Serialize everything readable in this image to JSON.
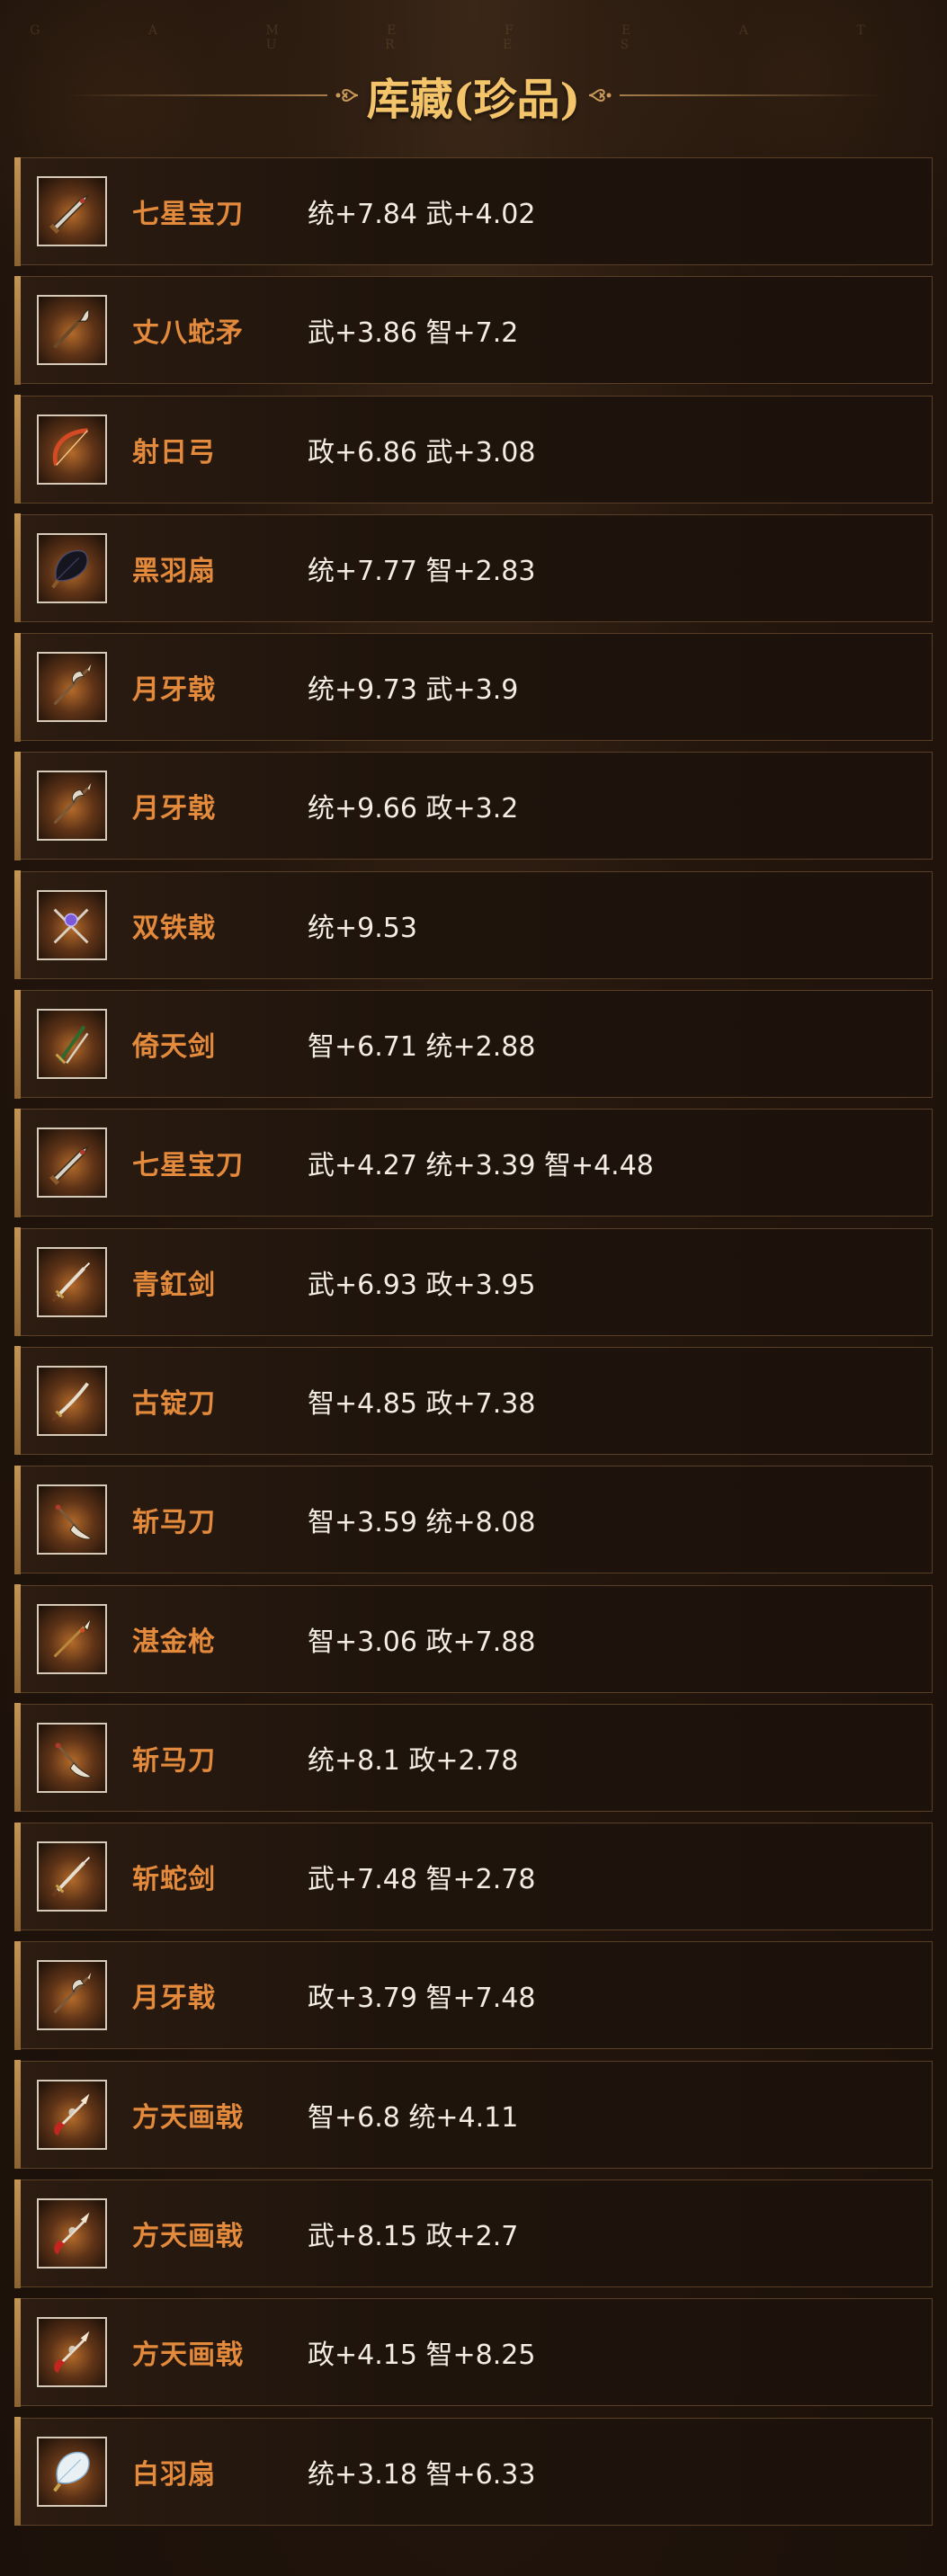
{
  "header": {
    "subtitle": "G A M E   F E A T U R E S",
    "title": "库藏(珍品)"
  },
  "items": [
    {
      "name": "七星宝刀",
      "stats": "统+7.84 武+4.02",
      "icon": "broadsword-icon"
    },
    {
      "name": "丈八蛇矛",
      "stats": "武+3.86 智+7.2",
      "icon": "serpent-spear-icon"
    },
    {
      "name": "射日弓",
      "stats": "政+6.86 武+3.08",
      "icon": "bow-icon"
    },
    {
      "name": "黑羽扇",
      "stats": "统+7.77 智+2.83",
      "icon": "black-feather-fan-icon"
    },
    {
      "name": "月牙戟",
      "stats": "统+9.73 武+3.9",
      "icon": "crescent-halberd-icon"
    },
    {
      "name": "月牙戟",
      "stats": "统+9.66 政+3.2",
      "icon": "crescent-halberd-icon"
    },
    {
      "name": "双铁戟",
      "stats": "统+9.53",
      "icon": "twin-halberd-icon"
    },
    {
      "name": "倚天剑",
      "stats": "智+6.71 统+2.88",
      "icon": "sword-pair-icon"
    },
    {
      "name": "七星宝刀",
      "stats": "武+4.27 统+3.39 智+4.48",
      "icon": "broadsword-icon"
    },
    {
      "name": "青釭剑",
      "stats": "武+6.93 政+3.95",
      "icon": "sword-icon"
    },
    {
      "name": "古锭刀",
      "stats": "智+4.85 政+7.38",
      "icon": "sabre-icon"
    },
    {
      "name": "斩马刀",
      "stats": "智+3.59 统+8.08",
      "icon": "glaive-icon"
    },
    {
      "name": "湛金枪",
      "stats": "智+3.06 政+7.88",
      "icon": "spear-icon"
    },
    {
      "name": "斩马刀",
      "stats": "统+8.1 政+2.78",
      "icon": "glaive-icon"
    },
    {
      "name": "斩蛇剑",
      "stats": "武+7.48 智+2.78",
      "icon": "sword-icon"
    },
    {
      "name": "月牙戟",
      "stats": "政+3.79 智+7.48",
      "icon": "crescent-halberd-icon"
    },
    {
      "name": "方天画戟",
      "stats": "智+6.8 统+4.11",
      "icon": "painted-halberd-icon"
    },
    {
      "name": "方天画戟",
      "stats": "武+8.15 政+2.7",
      "icon": "painted-halberd-icon"
    },
    {
      "name": "方天画戟",
      "stats": "政+4.15 智+8.25",
      "icon": "painted-halberd-icon"
    },
    {
      "name": "白羽扇",
      "stats": "统+3.18 智+6.33",
      "icon": "white-feather-fan-icon"
    }
  ],
  "colors": {
    "background": "#1c120b",
    "title": "#f3c46a",
    "item_name": "#e38a3c",
    "item_stats": "#f4ede2",
    "accent_bar": "#c49553",
    "row_border": "#5a3f27"
  }
}
